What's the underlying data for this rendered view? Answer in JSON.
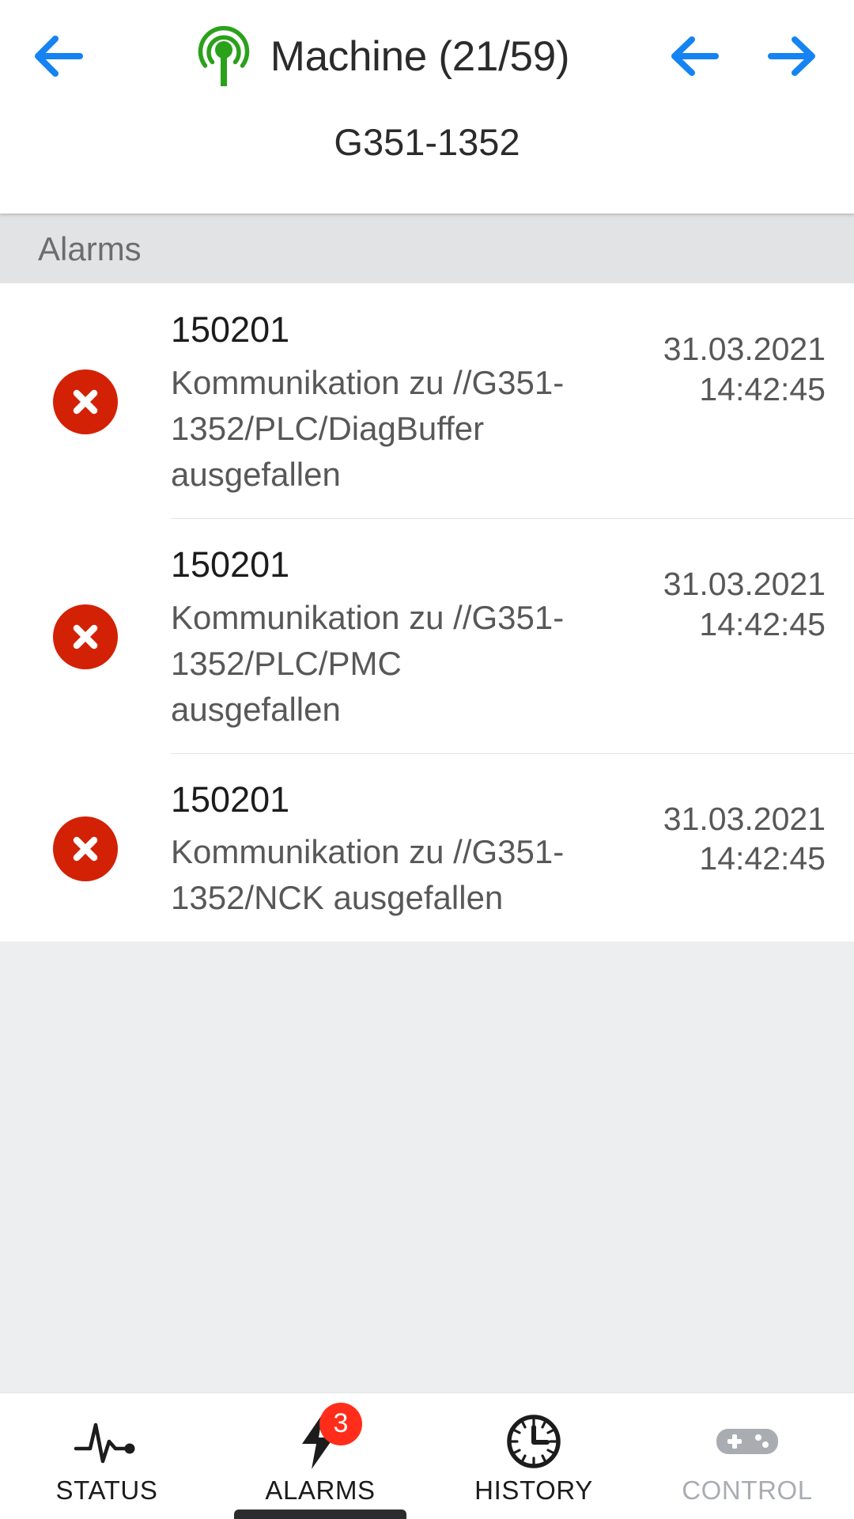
{
  "header": {
    "back_icon": "arrow-left-icon",
    "status_icon": "antenna-broadcast-icon",
    "status_color": "#2aa11a",
    "title": "Machine (21/59)",
    "subtitle": "G351-1352",
    "prev_icon": "arrow-left-icon",
    "next_icon": "arrow-right-icon",
    "nav_color": "#1583f2"
  },
  "section": {
    "label": "Alarms"
  },
  "alarms": {
    "error_color": "#d32106",
    "items": [
      {
        "severity_icon": "error-circle-x-icon",
        "code": "150201",
        "message": "Kommunikation zu //G351-1352/PLC/DiagBuffer ausgefallen",
        "date": "31.03.2021",
        "time": "14:42:45"
      },
      {
        "severity_icon": "error-circle-x-icon",
        "code": "150201",
        "message": "Kommunikation zu //G351-1352/PLC/PMC ausgefallen",
        "date": "31.03.2021",
        "time": "14:42:45"
      },
      {
        "severity_icon": "error-circle-x-icon",
        "code": "150201",
        "message": "Kommunikation zu //G351-1352/NCK ausgefallen",
        "date": "31.03.2021",
        "time": "14:42:45"
      }
    ]
  },
  "bottom_nav": {
    "active_index": 1,
    "badge_color": "#ff2d1a",
    "tabs": [
      {
        "label": "STATUS",
        "icon": "heartbeat-pulse-icon",
        "badge": null,
        "disabled": false
      },
      {
        "label": "ALARMS",
        "icon": "lightning-bolt-icon",
        "badge": "3",
        "disabled": false
      },
      {
        "label": "HISTORY",
        "icon": "clock-icon",
        "badge": null,
        "disabled": false
      },
      {
        "label": "CONTROL",
        "icon": "gamepad-icon",
        "badge": null,
        "disabled": true
      }
    ]
  }
}
